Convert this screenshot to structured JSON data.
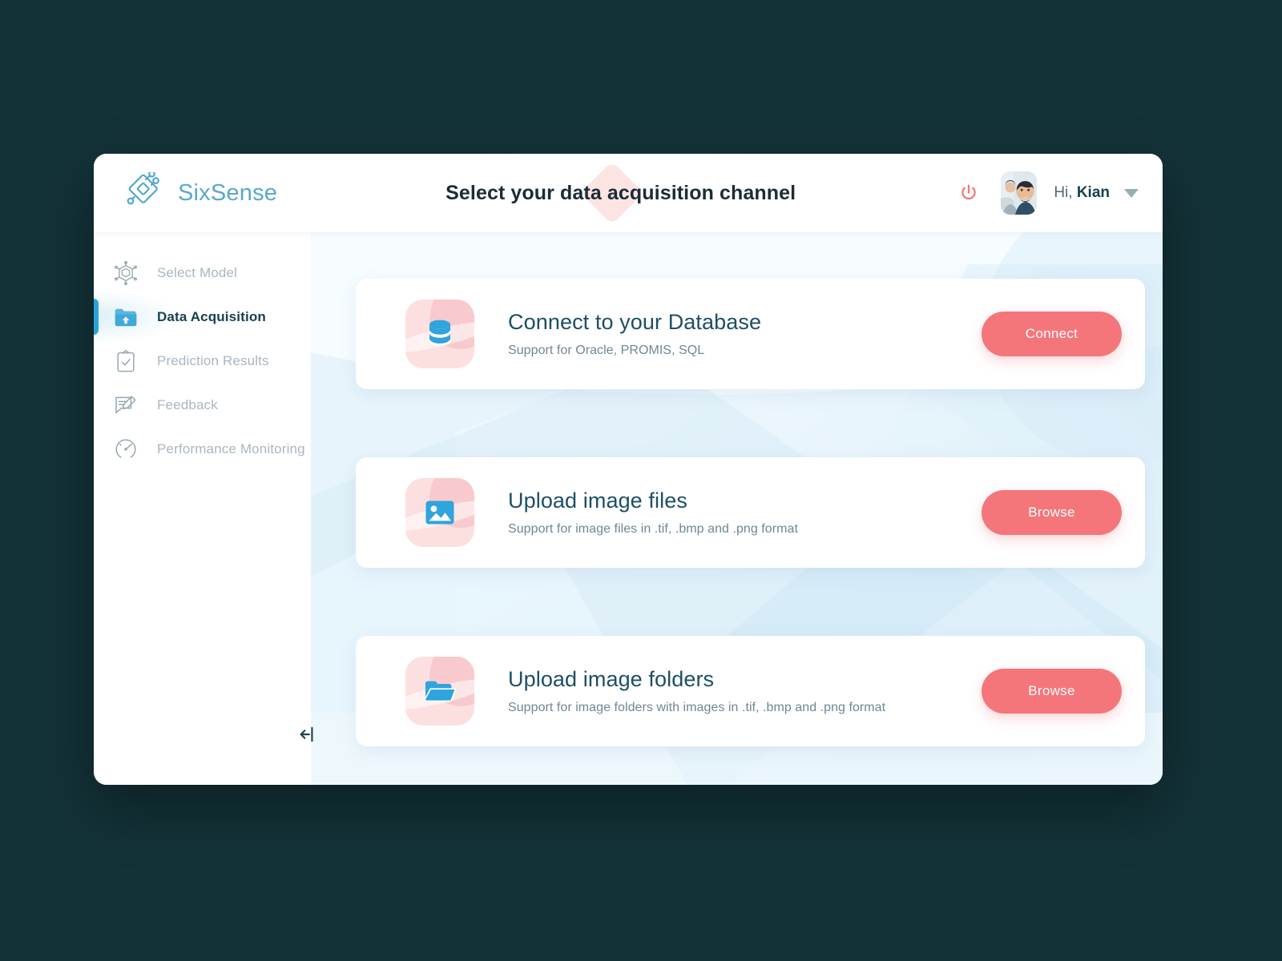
{
  "brand": {
    "name": "SixSense",
    "logo_icon": "sixsense-diamond-logo",
    "color": "#5ba8cc"
  },
  "header": {
    "title": "Select your data acquisition channel",
    "power_icon": "power-icon",
    "power_color": "#f4767b",
    "avatar_icon": "user-avatar-photo",
    "greeting_prefix": "Hi, ",
    "user_name": "Kian",
    "caret_icon": "chevron-down-icon"
  },
  "sidebar": {
    "collapse_icon": "collapse-sidebar-icon",
    "items": [
      {
        "label": "Select Model",
        "icon": "cube-model-icon",
        "active": false
      },
      {
        "label": "Data Acquisition",
        "icon": "folder-upload-icon",
        "active": true
      },
      {
        "label": "Prediction Results",
        "icon": "clipboard-check-icon",
        "active": false
      },
      {
        "label": "Feedback",
        "icon": "comment-edit-icon",
        "active": false
      },
      {
        "label": "Performance Monitoring",
        "icon": "gauge-speedometer-icon",
        "active": false
      }
    ]
  },
  "main": {
    "cards": [
      {
        "title": "Connect to your Database",
        "subtitle": "Support for Oracle, PROMIS, SQL",
        "icon": "database-icon",
        "button_label": "Connect"
      },
      {
        "title": "Upload image files",
        "subtitle": "Support for image files in .tif, .bmp and .png format",
        "icon": "image-file-icon",
        "button_label": "Browse"
      },
      {
        "title": "Upload image folders",
        "subtitle": "Support for image folders with images in .tif, .bmp and .png format",
        "icon": "folder-open-icon",
        "button_label": "Browse"
      }
    ]
  },
  "colors": {
    "page_background": "#133238",
    "accent_blue": "#29a3d9",
    "accent_coral": "#f4767b",
    "icon_tile_pink": "#fce0e0",
    "title_navy": "#1d4f64"
  }
}
